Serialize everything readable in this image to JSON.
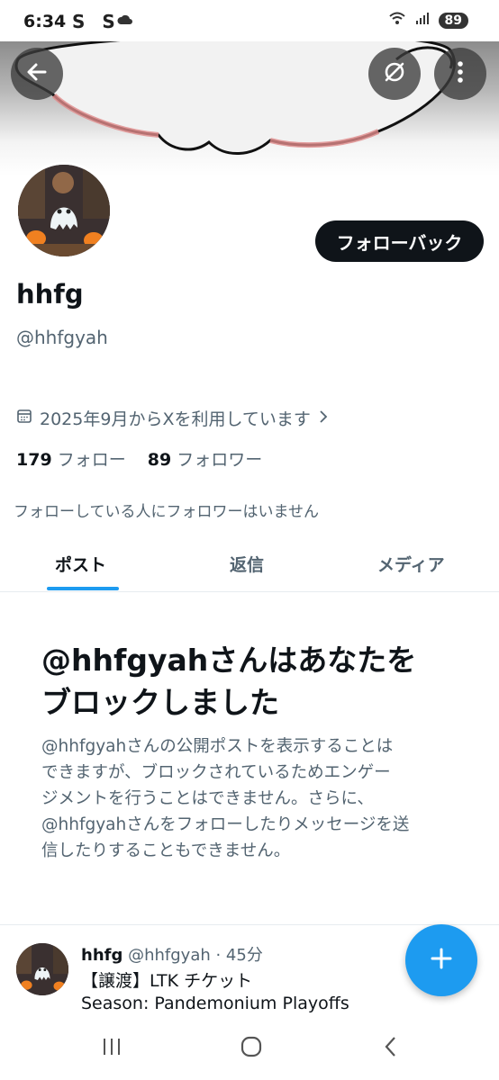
{
  "status_bar": {
    "time": "6:34",
    "notif_icons": "S S",
    "battery": "89"
  },
  "profile": {
    "display_name": "hhfg",
    "handle": "@hhfgyah",
    "follow_back_label": "フォローバック",
    "joined": "2025年9月からXを利用しています",
    "following_count": "179",
    "following_label": "フォロー",
    "followers_count": "89",
    "followers_label": "フォロワー",
    "followers_you_know": "フォローしている人にフォロワーはいません"
  },
  "tabs": [
    {
      "label": "ポスト",
      "active": true
    },
    {
      "label": "返信",
      "active": false
    },
    {
      "label": "メディア",
      "active": false
    }
  ],
  "blocked_notice": {
    "title_line1": "@hhfgyahさんはあなたを",
    "title_line2": "ブロックしました",
    "body_lines": [
      "@hhfgyahさんの公開ポストを表示することは",
      "できますが、ブロックされているためエンゲー",
      "ジメントを行うことはできません。さらに、",
      "@hhfgyahさんをフォローしたりメッセージを送",
      "信したりすることもできません。"
    ]
  },
  "post": {
    "author_name": "hhfg",
    "author_handle_time": "@hhfgyah · 45分",
    "lines": [
      "【譲渡】LTK チケット",
      "Season: Pandemonium Playoffs"
    ]
  },
  "colors": {
    "accent": "#1d9bf0",
    "text_primary": "#0f1419",
    "text_secondary": "#536471"
  },
  "icons": {
    "back": "arrow-left-icon",
    "grok": "grok-icon",
    "more": "more-vertical-icon",
    "calendar": "calendar-icon",
    "compose": "plus-icon"
  }
}
